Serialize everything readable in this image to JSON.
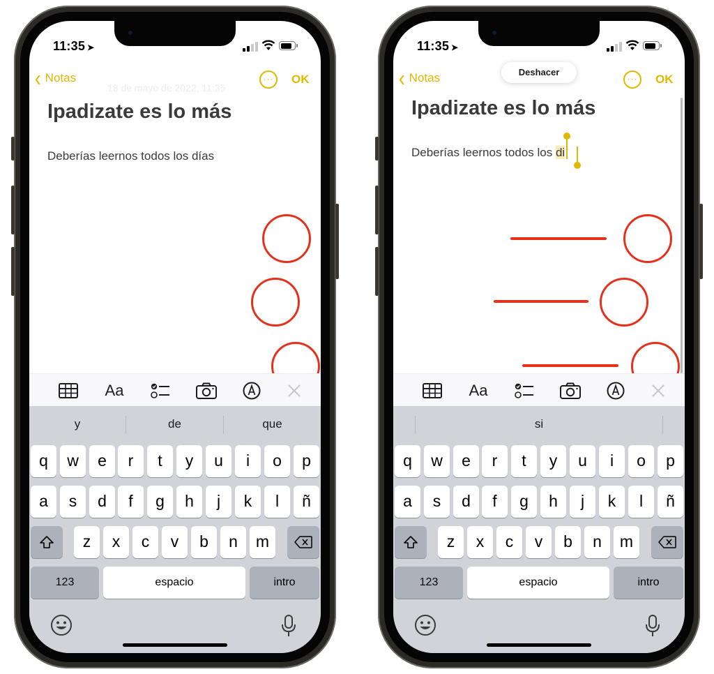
{
  "status": {
    "time": "11:35"
  },
  "nav": {
    "back_label": "Notas",
    "done_label": "OK",
    "more_label": "···"
  },
  "left": {
    "date_faded": "18 de mayo de 2022, 11:35",
    "note_title": "Ipadizate es lo más",
    "note_body": "Deberías leernos todos los días",
    "suggestions": [
      "y",
      "de",
      "que"
    ]
  },
  "right": {
    "undo_label": "Deshacer",
    "note_title": "Ipadizate es lo más",
    "note_body_prefix": "Deberías leernos todos los ",
    "note_body_selected": "di",
    "suggestions": [
      "si"
    ]
  },
  "toolbar": {
    "format_label": "Aa"
  },
  "keyboard": {
    "row1": [
      "q",
      "w",
      "e",
      "r",
      "t",
      "y",
      "u",
      "i",
      "o",
      "p"
    ],
    "row2": [
      "a",
      "s",
      "d",
      "f",
      "g",
      "h",
      "j",
      "k",
      "l",
      "ñ"
    ],
    "row3": [
      "z",
      "x",
      "c",
      "v",
      "b",
      "n",
      "m"
    ],
    "numbers_label": "123",
    "space_label": "espacio",
    "return_label": "intro"
  },
  "colors": {
    "accent": "#e2b700",
    "annotation": "#e5311c"
  }
}
